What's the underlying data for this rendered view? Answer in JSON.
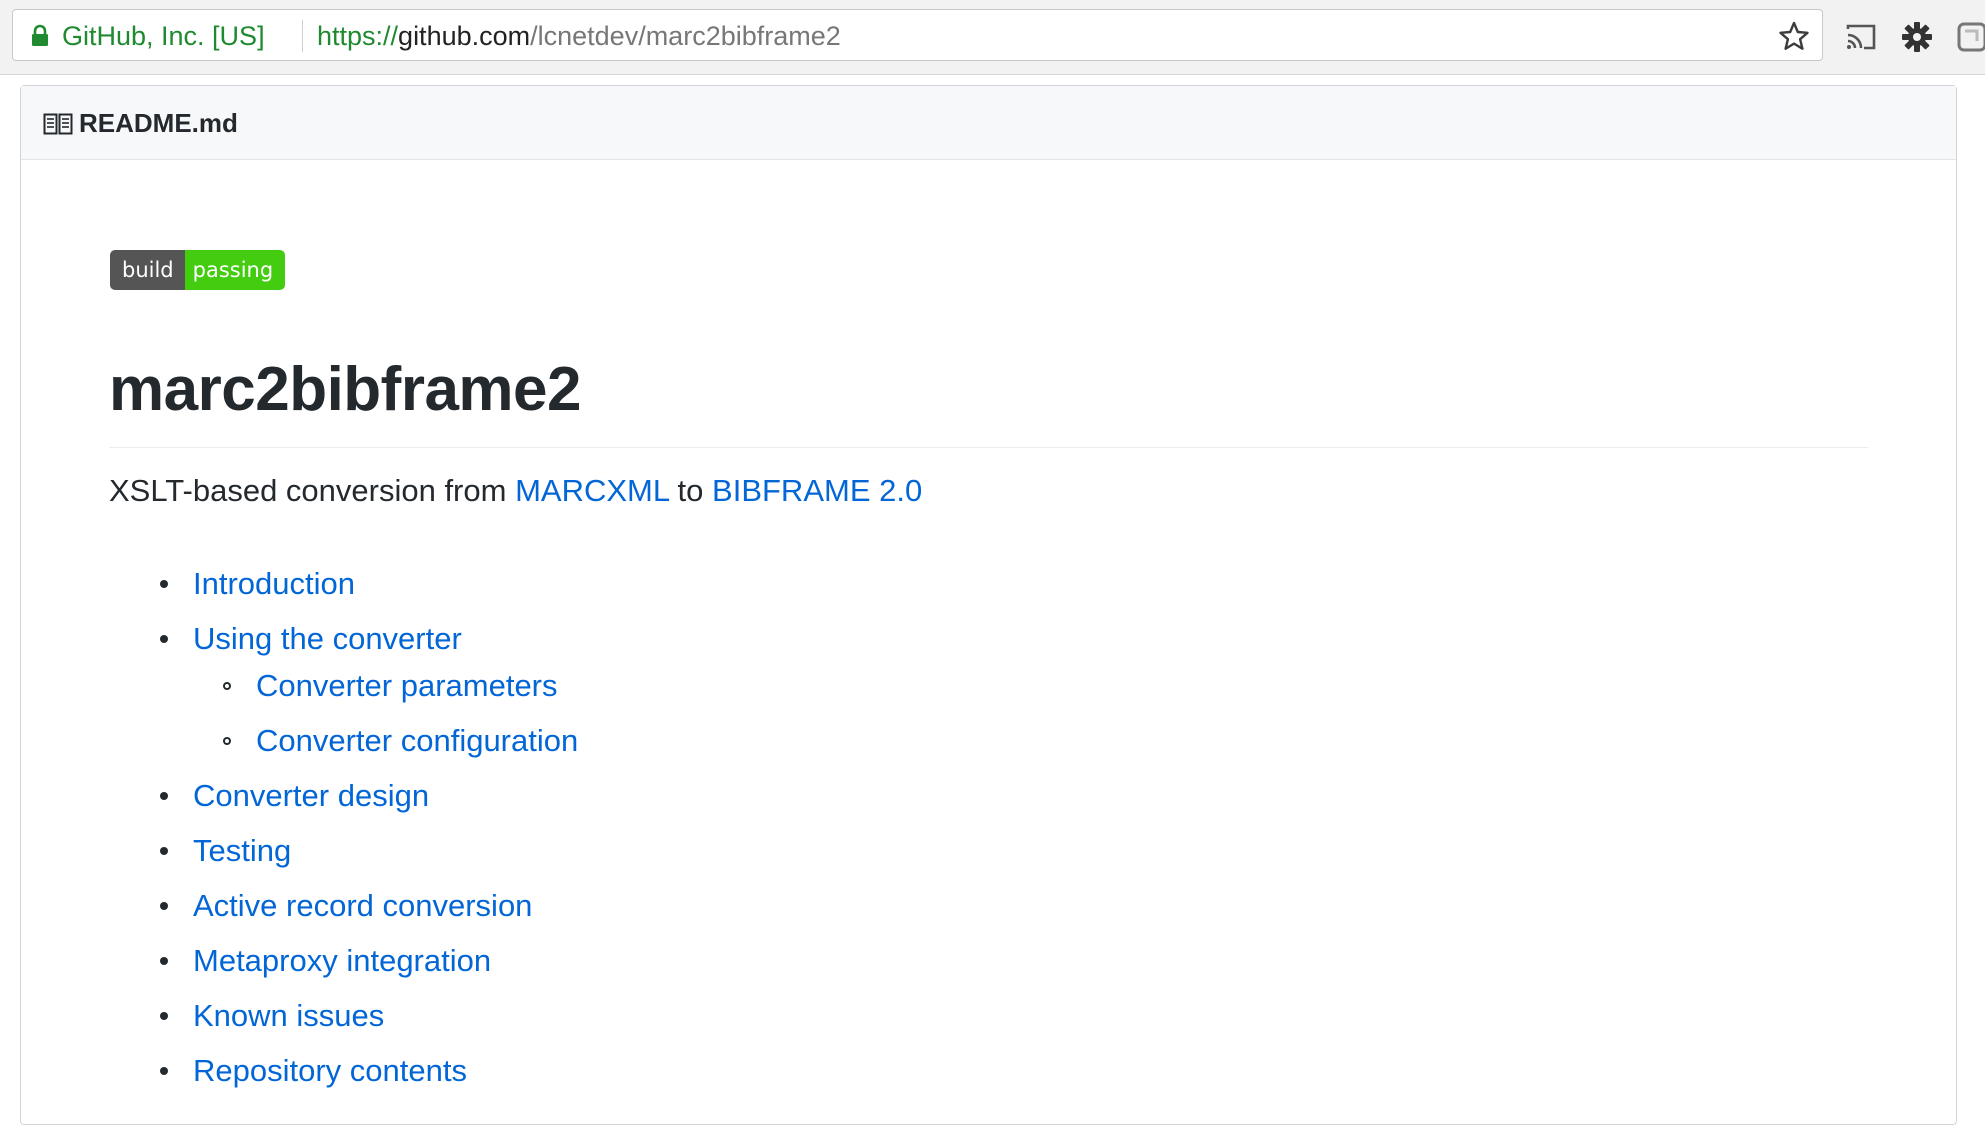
{
  "browser": {
    "site_identity": "GitHub, Inc. [US]",
    "url_scheme": "https://",
    "url_host": "github.com",
    "url_path": "/lcnetdev/marc2bibframe2",
    "icons": [
      "lock-icon",
      "star-icon",
      "cast-icon",
      "gear-icon",
      "extension-icon"
    ]
  },
  "readme": {
    "filename": "README.md",
    "badge": {
      "left": "build",
      "right": "passing",
      "left_color": "#555555",
      "right_color": "#44cc11"
    },
    "title": "marc2bibframe2",
    "description": {
      "prefix": "XSLT-based conversion from ",
      "link1": "MARCXML",
      "middle": " to ",
      "link2": "BIBFRAME 2.0"
    },
    "toc": [
      {
        "label": "Introduction",
        "level": 1
      },
      {
        "label": "Using the converter",
        "level": 1
      },
      {
        "label": "Converter parameters",
        "level": 2
      },
      {
        "label": "Converter configuration",
        "level": 2
      },
      {
        "label": "Converter design",
        "level": 1
      },
      {
        "label": "Testing",
        "level": 1
      },
      {
        "label": "Active record conversion",
        "level": 1
      },
      {
        "label": "Metaproxy integration",
        "level": 1
      },
      {
        "label": "Known issues",
        "level": 1
      },
      {
        "label": "Repository contents",
        "level": 1
      }
    ]
  },
  "colors": {
    "link": "#0366d6",
    "text": "#24292e",
    "secure_green": "#1f8a2f"
  }
}
